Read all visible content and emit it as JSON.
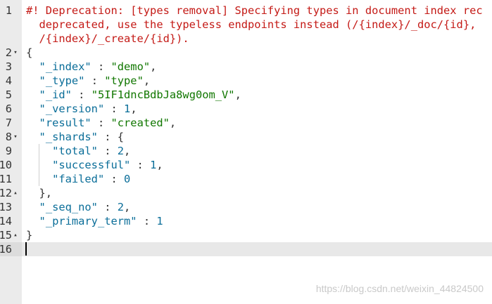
{
  "editor": {
    "lines": [
      {
        "num": "1",
        "fold": "",
        "segments": [
          {
            "t": "warn",
            "v": "#! Deprecation: [types removal] Specifying types in document index rec"
          }
        ]
      },
      {
        "num": "",
        "fold": "",
        "segments": [
          {
            "t": "warn",
            "v": "  deprecated, use the typeless endpoints instead (/{index}/_doc/{id},"
          }
        ]
      },
      {
        "num": "",
        "fold": "",
        "segments": [
          {
            "t": "warn",
            "v": "  /{index}/_create/{id})."
          }
        ]
      },
      {
        "num": "2",
        "fold": "▾",
        "segments": [
          {
            "t": "punc",
            "v": "{"
          }
        ]
      },
      {
        "num": "3",
        "fold": "",
        "segments": [
          {
            "t": "punc",
            "v": "  "
          },
          {
            "t": "key",
            "v": "\"_index\""
          },
          {
            "t": "punc",
            "v": " : "
          },
          {
            "t": "str",
            "v": "\"demo\""
          },
          {
            "t": "punc",
            "v": ","
          }
        ]
      },
      {
        "num": "4",
        "fold": "",
        "segments": [
          {
            "t": "punc",
            "v": "  "
          },
          {
            "t": "key",
            "v": "\"_type\""
          },
          {
            "t": "punc",
            "v": " : "
          },
          {
            "t": "str",
            "v": "\"type\""
          },
          {
            "t": "punc",
            "v": ","
          }
        ]
      },
      {
        "num": "5",
        "fold": "",
        "segments": [
          {
            "t": "punc",
            "v": "  "
          },
          {
            "t": "key",
            "v": "\"_id\""
          },
          {
            "t": "punc",
            "v": " : "
          },
          {
            "t": "str",
            "v": "\"5IF1dncBdbJa8wg0om_V\""
          },
          {
            "t": "punc",
            "v": ","
          }
        ]
      },
      {
        "num": "6",
        "fold": "",
        "segments": [
          {
            "t": "punc",
            "v": "  "
          },
          {
            "t": "key",
            "v": "\"_version\""
          },
          {
            "t": "punc",
            "v": " : "
          },
          {
            "t": "num",
            "v": "1"
          },
          {
            "t": "punc",
            "v": ","
          }
        ]
      },
      {
        "num": "7",
        "fold": "",
        "segments": [
          {
            "t": "punc",
            "v": "  "
          },
          {
            "t": "key",
            "v": "\"result\""
          },
          {
            "t": "punc",
            "v": " : "
          },
          {
            "t": "str",
            "v": "\"created\""
          },
          {
            "t": "punc",
            "v": ","
          }
        ]
      },
      {
        "num": "8",
        "fold": "▾",
        "segments": [
          {
            "t": "punc",
            "v": "  "
          },
          {
            "t": "key",
            "v": "\"_shards\""
          },
          {
            "t": "punc",
            "v": " : {"
          }
        ]
      },
      {
        "num": "9",
        "fold": "",
        "segments": [
          {
            "t": "punc",
            "v": "    "
          },
          {
            "t": "key",
            "v": "\"total\""
          },
          {
            "t": "punc",
            "v": " : "
          },
          {
            "t": "num",
            "v": "2"
          },
          {
            "t": "punc",
            "v": ","
          }
        ]
      },
      {
        "num": "10",
        "fold": "",
        "segments": [
          {
            "t": "punc",
            "v": "    "
          },
          {
            "t": "key",
            "v": "\"successful\""
          },
          {
            "t": "punc",
            "v": " : "
          },
          {
            "t": "num",
            "v": "1"
          },
          {
            "t": "punc",
            "v": ","
          }
        ]
      },
      {
        "num": "11",
        "fold": "",
        "segments": [
          {
            "t": "punc",
            "v": "    "
          },
          {
            "t": "key",
            "v": "\"failed\""
          },
          {
            "t": "punc",
            "v": " : "
          },
          {
            "t": "num",
            "v": "0"
          }
        ]
      },
      {
        "num": "12",
        "fold": "▴",
        "segments": [
          {
            "t": "punc",
            "v": "  },"
          }
        ]
      },
      {
        "num": "13",
        "fold": "",
        "segments": [
          {
            "t": "punc",
            "v": "  "
          },
          {
            "t": "key",
            "v": "\"_seq_no\""
          },
          {
            "t": "punc",
            "v": " : "
          },
          {
            "t": "num",
            "v": "2"
          },
          {
            "t": "punc",
            "v": ","
          }
        ]
      },
      {
        "num": "14",
        "fold": "",
        "segments": [
          {
            "t": "punc",
            "v": "  "
          },
          {
            "t": "key",
            "v": "\"_primary_term\""
          },
          {
            "t": "punc",
            "v": " : "
          },
          {
            "t": "num",
            "v": "1"
          }
        ]
      },
      {
        "num": "15",
        "fold": "▴",
        "segments": [
          {
            "t": "punc",
            "v": "}"
          }
        ]
      },
      {
        "num": "16",
        "fold": "",
        "segments": [],
        "active": true
      }
    ]
  },
  "watermark": "https://blog.csdn.net/weixin_44824500",
  "colors": {
    "gutter": "#ebebeb",
    "active_line": "#e8e8e8",
    "key": "#0b6e99",
    "string": "#117700",
    "warning": "#c41a16"
  }
}
